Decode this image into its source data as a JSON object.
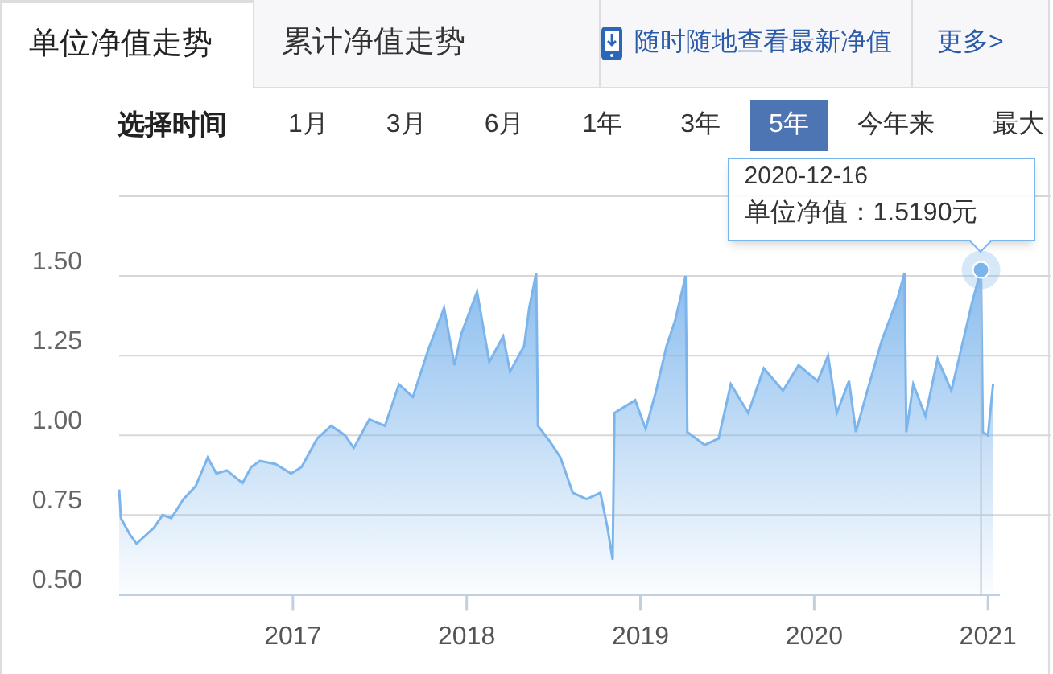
{
  "tabs": [
    {
      "label": "单位净值走势",
      "selected": true
    },
    {
      "label": "累计净值走势",
      "selected": false
    }
  ],
  "app_link": {
    "label": "随时随地查看最新净值"
  },
  "more_link": {
    "label": "更多>"
  },
  "time_range": {
    "label": "选择时间",
    "options": [
      {
        "label": "1月",
        "selected": false
      },
      {
        "label": "3月",
        "selected": false
      },
      {
        "label": "6月",
        "selected": false
      },
      {
        "label": "1年",
        "selected": false
      },
      {
        "label": "3年",
        "selected": false
      },
      {
        "label": "5年",
        "selected": true
      },
      {
        "label": "今年来",
        "selected": false
      },
      {
        "label": "最大",
        "selected": false
      }
    ]
  },
  "chart": {
    "chart_data": {
      "type": "area",
      "x": [
        2016.0,
        2016.01,
        2016.06,
        2016.1,
        2016.14,
        2016.2,
        2016.25,
        2016.3,
        2016.37,
        2016.44,
        2016.51,
        2016.56,
        2016.62,
        2016.71,
        2016.76,
        2016.81,
        2016.9,
        2016.99,
        2017.05,
        2017.14,
        2017.22,
        2017.3,
        2017.35,
        2017.44,
        2017.53,
        2017.61,
        2017.69,
        2017.78,
        2017.87,
        2017.93,
        2017.97,
        2018.06,
        2018.13,
        2018.21,
        2018.25,
        2018.33,
        2018.36,
        2018.4,
        2018.41,
        2018.48,
        2018.54,
        2018.61,
        2018.69,
        2018.77,
        2018.81,
        2018.84,
        2018.85,
        2018.97,
        2019.03,
        2019.09,
        2019.15,
        2019.2,
        2019.26,
        2019.27,
        2019.37,
        2019.45,
        2019.52,
        2019.62,
        2019.71,
        2019.82,
        2019.91,
        2020.02,
        2020.08,
        2020.13,
        2020.2,
        2020.24,
        2020.3,
        2020.39,
        2020.48,
        2020.52,
        2020.53,
        2020.57,
        2020.64,
        2020.71,
        2020.79,
        2020.91,
        2020.96,
        2020.97,
        2021.0,
        2021.03
      ],
      "series": [
        {
          "color": "#7cb5ec",
          "values": [
            0.83,
            0.74,
            0.69,
            0.66,
            0.68,
            0.71,
            0.75,
            0.74,
            0.8,
            0.84,
            0.93,
            0.88,
            0.89,
            0.85,
            0.9,
            0.92,
            0.91,
            0.88,
            0.9,
            0.99,
            1.03,
            1.0,
            0.96,
            1.05,
            1.03,
            1.16,
            1.12,
            1.27,
            1.4,
            1.22,
            1.32,
            1.45,
            1.23,
            1.31,
            1.2,
            1.28,
            1.4,
            1.51,
            1.03,
            0.98,
            0.93,
            0.82,
            0.8,
            0.82,
            0.71,
            0.61,
            1.07,
            1.11,
            1.02,
            1.14,
            1.28,
            1.36,
            1.5,
            1.01,
            0.97,
            0.99,
            1.16,
            1.07,
            1.21,
            1.14,
            1.22,
            1.17,
            1.25,
            1.07,
            1.17,
            1.01,
            1.13,
            1.3,
            1.43,
            1.51,
            1.01,
            1.16,
            1.06,
            1.24,
            1.14,
            1.42,
            1.519,
            1.01,
            1.0,
            1.16
          ]
        }
      ],
      "xlim": [
        2016.0,
        2021.05
      ],
      "ylim": [
        0.5,
        1.75
      ],
      "xticks": [
        {
          "value": 2017,
          "label": "2017"
        },
        {
          "value": 2018,
          "label": "2018"
        },
        {
          "value": 2019,
          "label": "2019"
        },
        {
          "value": 2020,
          "label": "2020"
        },
        {
          "value": 2021,
          "label": "2021"
        }
      ],
      "yticks": [
        {
          "value": 0.5,
          "label": "0.50"
        },
        {
          "value": 0.75,
          "label": "0.75"
        },
        {
          "value": 1,
          "label": "1.00"
        },
        {
          "value": 1.25,
          "label": "1.25"
        },
        {
          "value": 1.5,
          "label": "1.50"
        }
      ],
      "grid": true,
      "ref_lines": [
        {
          "axis": "x",
          "value": 2020.96
        }
      ],
      "annotations": [
        {
          "x": 2020.96,
          "y": 1.519,
          "text": "2020-12-16\n单位净值：1.5190元"
        }
      ]
    }
  }
}
